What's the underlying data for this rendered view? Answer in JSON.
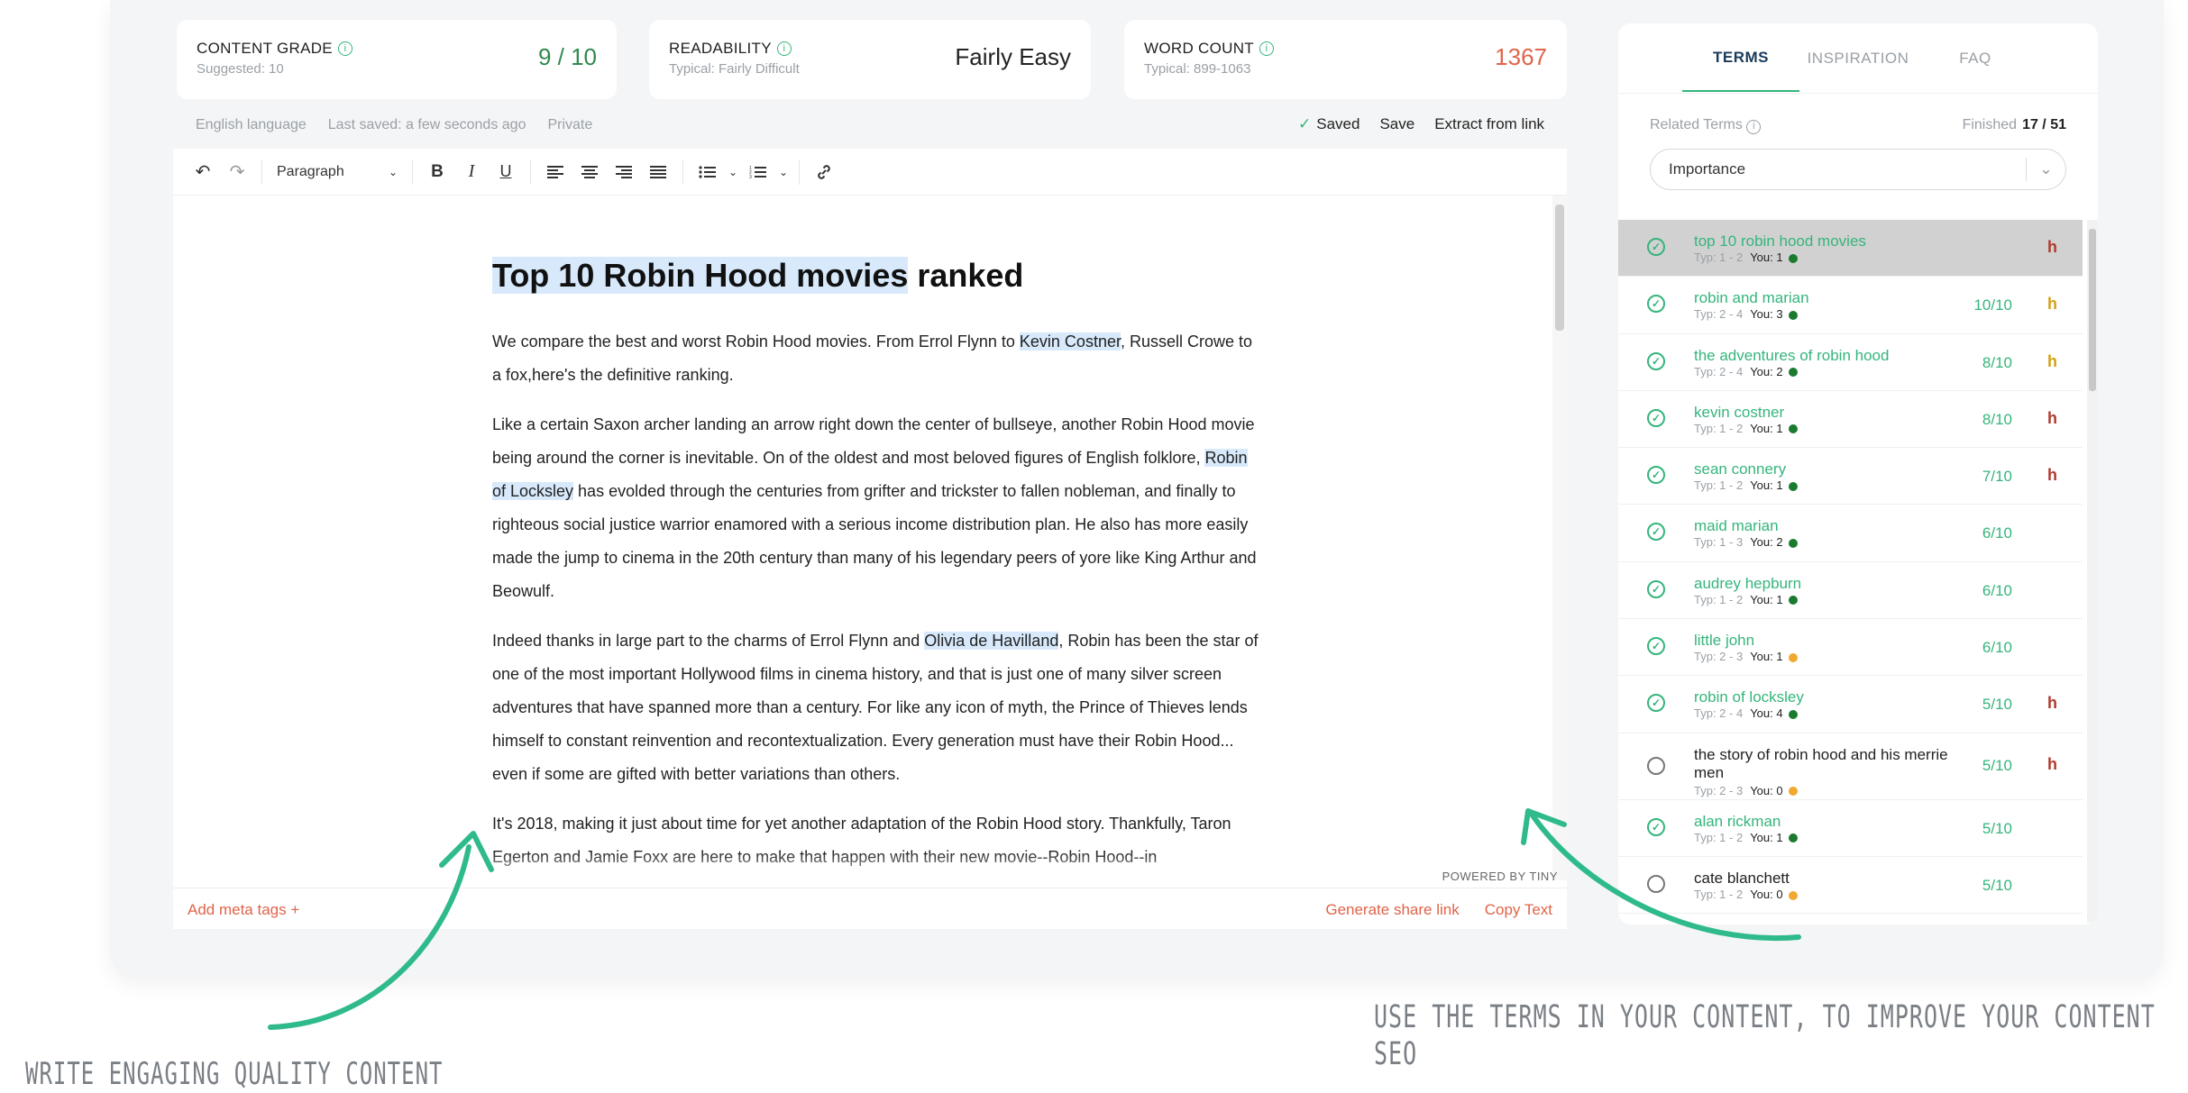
{
  "metrics": [
    {
      "label": "CONTENT GRADE",
      "sub": "Suggested: 10",
      "value": "9 / 10",
      "color": "#2f8a4e"
    },
    {
      "label": "READABILITY",
      "sub": "Typical: Fairly Difficult",
      "value": "Fairly Easy",
      "color": "#222222"
    },
    {
      "label": "WORD COUNT",
      "sub": "Typical: 899-1063",
      "value": "1367",
      "color": "#e0644a"
    }
  ],
  "meta": {
    "language": "English language",
    "saved_time": "Last saved: a few seconds ago",
    "privacy": "Private"
  },
  "save_bar": {
    "saved": "Saved",
    "save": "Save",
    "extract": "Extract from link"
  },
  "toolbar": {
    "block_format": "Paragraph"
  },
  "article": {
    "title_highlight": "Top 10 Robin Hood movies",
    "title_rest": " ranked",
    "p1_a": "We compare the best and worst Robin Hood movies. From Errol Flynn to ",
    "p1_hl": "Kevin Costner",
    "p1_b": ", Russell Crowe to a fox,here's the definitive ranking.",
    "p2_a": "Like a certain Saxon archer landing an arrow right down the center of bullseye, another Robin Hood movie being around the corner is inevitable. On of the oldest and most beloved figures of English folklore, ",
    "p2_hl": "Robin of Locksley",
    "p2_b": " has evolded through the centuries from grifter and trickster to fallen nobleman, and finally to righteous social justice warrior enamored with a serious income distribution plan. He also has more easily made the jump to cinema in the 20th century than many of his legendary peers of yore like King Arthur and Beowulf.",
    "p3_a": "Indeed thanks in large part to the charms of Errol Flynn and ",
    "p3_hl": "Olivia de Havilland",
    "p3_b": ", Robin has been the star of one of the most important Hollywood films in cinema history, and that is just one of many silver screen adventures that have spanned more than a century. For like any icon of myth, the Prince of Thieves lends himself to constant reinvention and recontextualization. Every generation must have their Robin Hood... even if some are gifted with better variations than others.",
    "p4": "It's 2018, making it just about time for yet another adaptation of the Robin Hood story. Thankfully, Taron Egerton and Jamie Foxx are here to make that happen with their new movie--Robin Hood--in"
  },
  "powered": "POWERED BY TINY",
  "footer": {
    "meta_tags": "Add meta tags +",
    "share": "Generate share link",
    "copy": "Copy Text"
  },
  "sidebar": {
    "tabs": [
      "TERMS",
      "INSPIRATION",
      "FAQ"
    ],
    "related_label": "Related Terms",
    "finished_label": "Finished",
    "finished_value": "17 / 51",
    "sort": "Importance",
    "terms": [
      {
        "name": "top 10 robin hood movies",
        "typ": "Typ: 1 - 2",
        "you": "You: 1",
        "dot": "#1a7a2e",
        "score": "",
        "h": "h",
        "hcolor": "#b03a2e",
        "done": true
      },
      {
        "name": "robin and marian",
        "typ": "Typ: 2 - 4",
        "you": "You: 3",
        "dot": "#1a7a2e",
        "score": "10/10",
        "h": "h",
        "hcolor": "#d4a017",
        "done": true
      },
      {
        "name": "the adventures of robin hood",
        "typ": "Typ: 2 - 4",
        "you": "You: 2",
        "dot": "#1a7a2e",
        "score": "8/10",
        "h": "h",
        "hcolor": "#d4a017",
        "done": true
      },
      {
        "name": "kevin costner",
        "typ": "Typ: 1 - 2",
        "you": "You: 1",
        "dot": "#1a7a2e",
        "score": "8/10",
        "h": "h",
        "hcolor": "#b03a2e",
        "done": true
      },
      {
        "name": "sean connery",
        "typ": "Typ: 1 - 2",
        "you": "You: 1",
        "dot": "#1a7a2e",
        "score": "7/10",
        "h": "h",
        "hcolor": "#b03a2e",
        "done": true
      },
      {
        "name": "maid marian",
        "typ": "Typ: 1 - 3",
        "you": "You: 2",
        "dot": "#1a7a2e",
        "score": "6/10",
        "h": "",
        "hcolor": "#b03a2e",
        "done": true
      },
      {
        "name": "audrey hepburn",
        "typ": "Typ: 1 - 2",
        "you": "You: 1",
        "dot": "#1a7a2e",
        "score": "6/10",
        "h": "",
        "hcolor": "#b03a2e",
        "done": true
      },
      {
        "name": "little john",
        "typ": "Typ: 2 - 3",
        "you": "You: 1",
        "dot": "#f0a830",
        "score": "6/10",
        "h": "",
        "hcolor": "#b03a2e",
        "done": true
      },
      {
        "name": "robin of locksley",
        "typ": "Typ: 2 - 4",
        "you": "You: 4",
        "dot": "#1a7a2e",
        "score": "5/10",
        "h": "h",
        "hcolor": "#b03a2e",
        "done": true
      },
      {
        "name": "the story of robin hood and his merrie men",
        "typ": "Typ: 2 - 3",
        "you": "You: 0",
        "dot": "#f0a830",
        "score": "5/10",
        "h": "h",
        "hcolor": "#b03a2e",
        "done": false
      },
      {
        "name": "alan rickman",
        "typ": "Typ: 1 - 2",
        "you": "You: 1",
        "dot": "#1a7a2e",
        "score": "5/10",
        "h": "",
        "hcolor": "#b03a2e",
        "done": true
      },
      {
        "name": "cate blanchett",
        "typ": "Typ: 1 - 2",
        "you": "You: 0",
        "dot": "#f0a830",
        "score": "5/10",
        "h": "",
        "hcolor": "#b03a2e",
        "done": false
      }
    ]
  },
  "notes": {
    "left": "WRITE ENGAGING QUALITY CONTENT",
    "right": "USE THE TERMS IN YOUR CONTENT, TO IMPROVE YOUR CONTENT SEO"
  },
  "accent": "#35b57c"
}
